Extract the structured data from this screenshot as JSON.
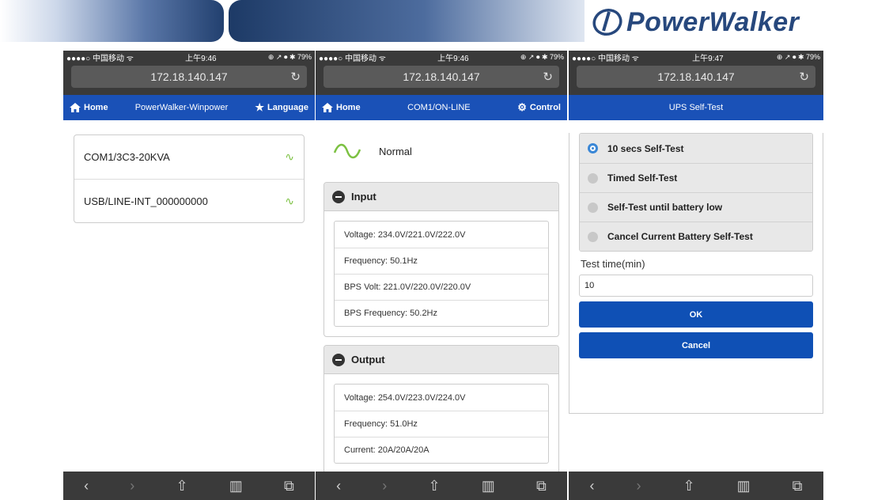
{
  "banner": {
    "logo_text": "PowerWalker"
  },
  "phones": [
    {
      "status": {
        "carrier": "●●●●○ 中国移动 ᯤ",
        "time": "上午9:46",
        "right": "⊕ ↗ ⏺ ✱ 79%"
      },
      "url": "172.18.140.147",
      "nav": {
        "home": "Home",
        "title": "PowerWalker-Winpower",
        "language": "Language"
      },
      "devices": [
        "COM1/3C3-20KVA",
        "USB/LINE-INT_000000000"
      ]
    },
    {
      "status": {
        "carrier": "●●●●○ 中国移动 ᯤ",
        "time": "上午9:46",
        "right": "⊕ ↗ ⏺ ✱ 79%"
      },
      "url": "172.18.140.147",
      "nav": {
        "home": "Home",
        "title": "COM1/ON-LINE",
        "control": "Control"
      },
      "status_text": "Normal",
      "input": {
        "title": "Input",
        "rows": [
          "Voltage: 234.0V/221.0V/222.0V",
          "Frequency: 50.1Hz",
          "BPS Volt: 221.0V/220.0V/220.0V",
          "BPS Frequency: 50.2Hz"
        ]
      },
      "output": {
        "title": "Output",
        "rows": [
          "Voltage: 254.0V/223.0V/224.0V",
          "Frequency: 51.0Hz",
          "Current: 20A/20A/20A"
        ]
      }
    },
    {
      "status": {
        "carrier": "●●●●○ 中国移动 ᯤ",
        "time": "上午9:47",
        "right": "⊕ ↗ ⏺ ✱ 79%"
      },
      "url": "172.18.140.147",
      "nav": {
        "title": "UPS Self-Test"
      },
      "options": [
        "10 secs Self-Test",
        "Timed Self-Test",
        "Self-Test until battery low",
        "Cancel Current Battery Self-Test"
      ],
      "selected_option": "10 secs Self-Test",
      "test_time_label": "Test time(min)",
      "test_time_value": "10",
      "ok_label": "OK",
      "cancel_label": "Cancel"
    }
  ],
  "toolbar": {
    "back": "‹",
    "forward": "›",
    "share": "⇧",
    "bookmarks": "📖",
    "tabs": "⧉"
  },
  "colors": {
    "nav_blue": "#1a51b7",
    "button_blue": "#0f50b5",
    "accent_green": "#7cc142",
    "radio_blue": "#3a87d6",
    "browser_dark": "#3a3a3a"
  }
}
